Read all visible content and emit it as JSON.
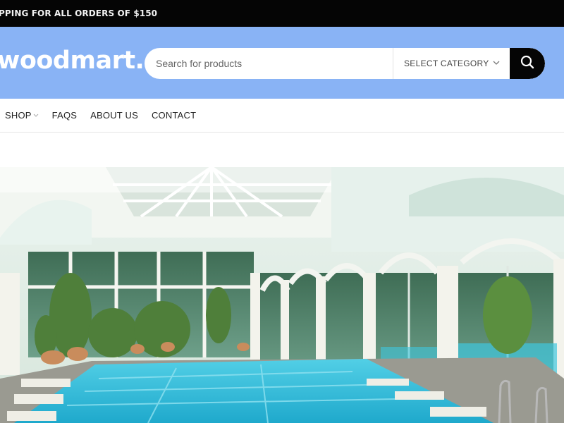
{
  "topbar": {
    "promo_text": "PPING FOR ALL ORDERS OF $150"
  },
  "header": {
    "logo_text": "woodmart.",
    "search": {
      "placeholder": "Search for products",
      "value": ""
    },
    "category": {
      "selected": "SELECT CATEGORY"
    },
    "search_icon": "search-icon"
  },
  "nav": {
    "items": [
      {
        "label": "SHOP",
        "has_dropdown": true
      },
      {
        "label": "FAQS"
      },
      {
        "label": "ABOUT US"
      },
      {
        "label": "CONTACT"
      }
    ]
  },
  "hero": {
    "image_subject": "indoor swimming pool under glass conservatory roof"
  },
  "colors": {
    "topbar_bg": "#050505",
    "header_bg": "#89b3f5",
    "search_button_bg": "#050505",
    "pool_water": "#39c4de"
  }
}
